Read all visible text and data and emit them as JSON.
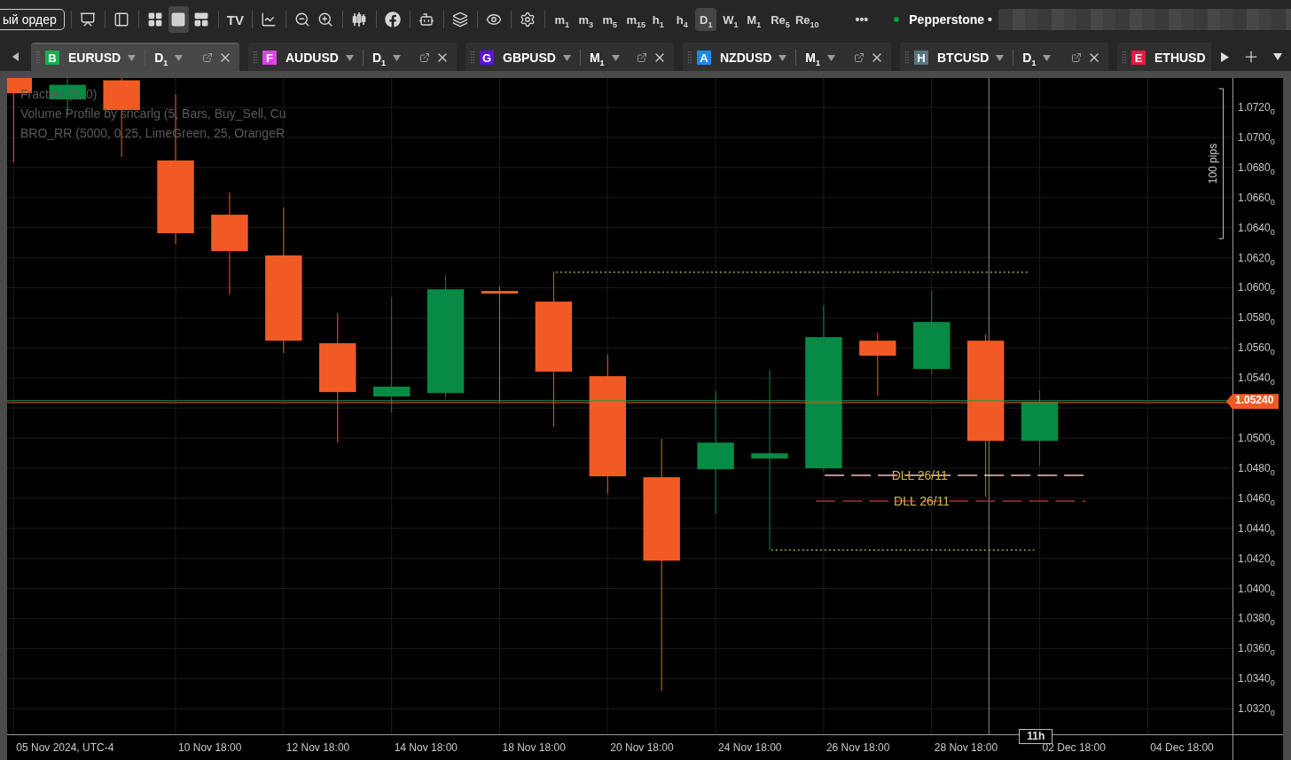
{
  "toolbar": {
    "order_button": "ый ордер",
    "tool_groups": [
      {
        "kind": "tools",
        "items": [
          {
            "kind": "chart-monitor"
          }
        ]
      },
      {
        "kind": "tools",
        "items": [
          {
            "kind": "panel"
          }
        ]
      },
      {
        "kind": "layouts",
        "items": [
          {
            "kind": "grid",
            "selected": false
          },
          {
            "kind": "single",
            "selected": true
          },
          {
            "kind": "split",
            "selected": false
          }
        ]
      },
      {
        "kind": "tools",
        "items": [
          {
            "kind": "tv",
            "label": "TV"
          }
        ]
      },
      {
        "kind": "tools",
        "items": [
          {
            "kind": "chart-add"
          }
        ]
      },
      {
        "kind": "tools",
        "items": [
          {
            "kind": "zoom-out"
          },
          {
            "kind": "zoom-in"
          }
        ]
      },
      {
        "kind": "tools",
        "items": [
          {
            "kind": "candles"
          }
        ]
      },
      {
        "kind": "tools",
        "items": [
          {
            "kind": "facebook"
          }
        ]
      },
      {
        "kind": "tools",
        "items": [
          {
            "kind": "bot"
          }
        ]
      },
      {
        "kind": "tools",
        "items": [
          {
            "kind": "layers"
          }
        ]
      },
      {
        "kind": "tools",
        "items": [
          {
            "kind": "eye"
          }
        ]
      },
      {
        "kind": "tools",
        "items": [
          {
            "kind": "chart-settings"
          }
        ]
      }
    ],
    "timeframes": [
      {
        "label": "m$_{1}$",
        "selected": false
      },
      {
        "label": "m$_{3}$",
        "selected": false
      },
      {
        "label": "m$_{5}$",
        "selected": false
      },
      {
        "label": "m$_{15}$",
        "selected": false
      },
      {
        "label": "h$_{1}$",
        "selected": false
      },
      {
        "label": "h$_{4}$",
        "selected": false
      },
      {
        "label": "D$_{1}$",
        "selected": true
      },
      {
        "label": "W$_{1}$",
        "selected": false
      },
      {
        "label": "M$_{1}$",
        "selected": false
      },
      {
        "label": "Re$_{5}$",
        "selected": false
      },
      {
        "label": "Re$_{10}$",
        "selected": false
      }
    ],
    "more": "•••",
    "broker": {
      "name": "Pepperstone •",
      "connected": true
    }
  },
  "tabs": [
    {
      "badge": "B",
      "color": "#14b14c",
      "symbol": "EURUSD",
      "timeframe": "D$_{1}$",
      "selected": true
    },
    {
      "badge": "F",
      "color": "#e040e8",
      "symbol": "AUDUSD",
      "timeframe": "D$_{1}$",
      "selected": false
    },
    {
      "badge": "G",
      "color": "#5a14d8",
      "symbol": "GBPUSD",
      "timeframe": "M$_{1}$",
      "selected": false
    },
    {
      "badge": "A",
      "color": "#1e88e5",
      "symbol": "NZDUSD",
      "timeframe": "M$_{1}$",
      "selected": false
    },
    {
      "badge": "H",
      "color": "#587682",
      "symbol": "BTCUSD",
      "timeframe": "D$_{1}$",
      "selected": false
    },
    {
      "badge": "E",
      "color": "#e8173f",
      "symbol": "ETHUSD",
      "selected": false
    }
  ],
  "chart": {
    "indicators": [
      "Fractals (5, 0)",
      "Volume Profile by sricarlg (5, Bars, Buy_Sell, Cu",
      "BRO_RR (5000, 0.25, LimeGreen, 25, OrangeR"
    ],
    "levels": [
      {
        "label": "DLL 26/11"
      },
      {
        "label": "DLL 26/11"
      }
    ],
    "range_label": "100 pips",
    "price_axis": [
      {
        "kind": "tick",
        "label": "1.0720$_{0}$"
      },
      {
        "kind": "tick",
        "label": "1.0700$_{0}$"
      },
      {
        "kind": "tick",
        "label": "1.0680$_{0}$"
      },
      {
        "kind": "tick",
        "label": "1.0660$_{0}$"
      },
      {
        "kind": "tick",
        "label": "1.0640$_{0}$"
      },
      {
        "kind": "tick",
        "label": "1.0620$_{0}$"
      },
      {
        "kind": "tick",
        "label": "1.0600$_{0}$"
      },
      {
        "kind": "tick",
        "label": "1.0580$_{0}$"
      },
      {
        "kind": "tick",
        "label": "1.0560$_{0}$"
      },
      {
        "kind": "tick",
        "label": "1.0540$_{0}$"
      },
      {
        "kind": "price_tag",
        "label": "1.05240"
      },
      {
        "kind": "tick",
        "label": "1.0500$_{0}$"
      },
      {
        "kind": "tick",
        "label": "1.0480$_{0}$"
      },
      {
        "kind": "tick",
        "label": "1.0460$_{0}$"
      },
      {
        "kind": "tick",
        "label": "1.0440$_{0}$"
      },
      {
        "kind": "tick",
        "label": "1.0420$_{0}$"
      },
      {
        "kind": "tick",
        "label": "1.0400$_{0}$"
      },
      {
        "kind": "tick",
        "label": "1.0380$_{0}$"
      },
      {
        "kind": "tick",
        "label": "1.0360$_{0}$"
      },
      {
        "kind": "tick",
        "label": "1.0340$_{0}$"
      },
      {
        "kind": "tick",
        "label": "1.0320$_{0}$"
      }
    ],
    "time_axis": [
      "05 Nov 2024, UTC-4",
      "10 Nov 18:00",
      "12 Nov 18:00",
      "14 Nov 18:00",
      "18 Nov 18:00",
      "20 Nov 18:00",
      "24 Nov 18:00",
      "26 Nov 18:00",
      "28 Nov 18:00",
      "02 Dec 18:00",
      "04 Dec 18:00"
    ],
    "time_tag": "11h"
  }
}
